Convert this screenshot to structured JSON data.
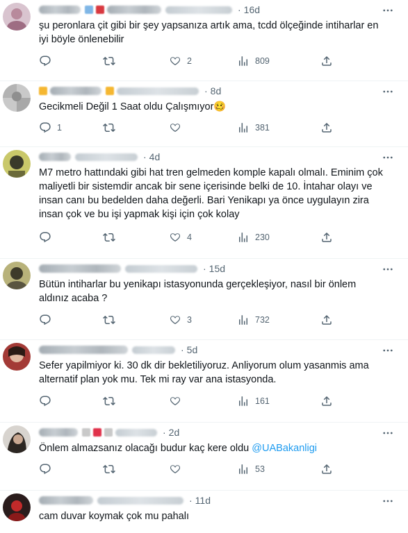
{
  "colors": {
    "text": "#0f1419",
    "secondary": "#536471",
    "link": "#1d9bf0",
    "divider": "#eff3f4"
  },
  "tweets": [
    {
      "time": "16d",
      "text": "şu peronlara çit gibi bir şey yapsanıza artık ama, tcdd ölçeğinde intiharlar en iyi böyle önlenebilir",
      "reply_count": "",
      "like_count": "2",
      "view_count": "809"
    },
    {
      "time": "8d",
      "text": "Gecikmeli Değil 1 Saat oldu Çalışmıyor🥴",
      "reply_count": "1",
      "like_count": "",
      "view_count": "381"
    },
    {
      "time": "4d",
      "text": "M7 metro hattındaki gibi hat tren gelmeden komple kapalı olmalı. Eminim çok maliyetli bir sistemdir ancak bir sene içerisinde belki de 10. İntahar olayı ve insan canı bu bedelden daha değerli. Bari Yenikapı ya önce uygulayın zira insan çok ve bu işi yapmak kişi için çok kolay",
      "reply_count": "",
      "like_count": "4",
      "view_count": "230"
    },
    {
      "time": "15d",
      "text": "Bütün intiharlar bu yenikapı istasyonunda gerçekleşiyor, nasıl bir önlem aldınız acaba ?",
      "reply_count": "",
      "like_count": "3",
      "view_count": "732"
    },
    {
      "time": "5d",
      "text": "Sefer yapilmiyor ki. 30 dk dir bekletiliyoruz. Anliyorum olum yasanmis ama alternatif plan yok mu. Tek mi ray var ana istasyonda.",
      "reply_count": "",
      "like_count": "",
      "view_count": "161"
    },
    {
      "time": "2d",
      "text_prefix": "Önlem almazsanız olacağı budur kaç kere oldu ",
      "mention": "@UABakanligi",
      "reply_count": "",
      "like_count": "",
      "view_count": "53"
    },
    {
      "time": "11d",
      "text": "cam duvar koymak çok mu pahalı"
    }
  ],
  "icons": {
    "reply": "reply-icon",
    "retweet": "retweet-icon",
    "like": "heart-icon",
    "views": "views-icon",
    "share": "share-icon",
    "more": "more-icon"
  }
}
